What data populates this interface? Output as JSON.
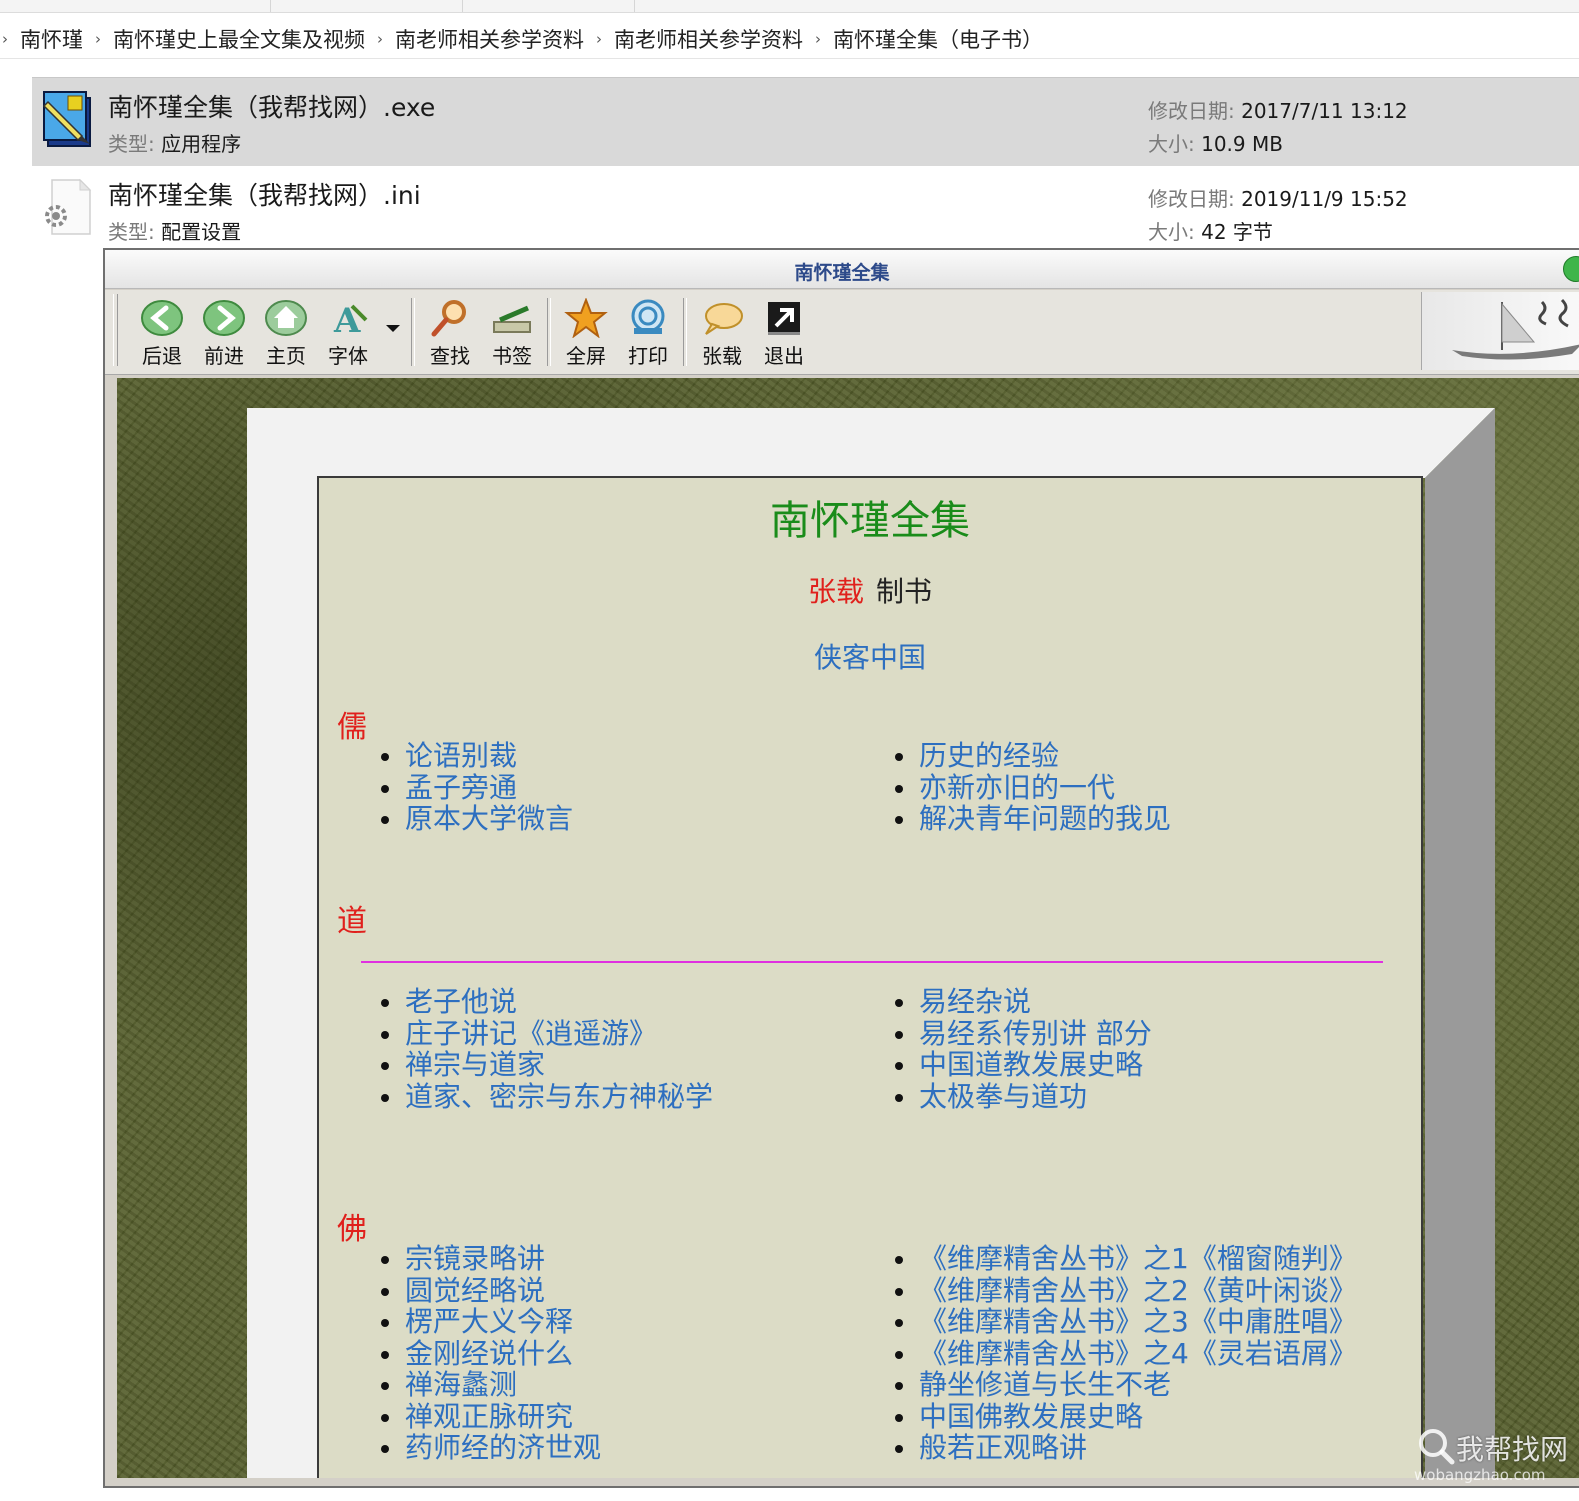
{
  "breadcrumb": {
    "items": [
      "南怀瑾",
      "南怀瑾史上最全文集及视频",
      "南老师相关参学资料",
      "南老师相关参学资料",
      "南怀瑾全集（电子书）"
    ]
  },
  "files": [
    {
      "name": "南怀瑾全集（我帮找网）.exe",
      "type_label": "类型:",
      "type_value": "应用程序",
      "date_label": "修改日期:",
      "date_value": "2017/7/11 13:12",
      "size_label": "大小:",
      "size_value": "10.9 MB",
      "icon": "ebook-app-icon",
      "selected": true
    },
    {
      "name": "南怀瑾全集（我帮找网）.ini",
      "type_label": "类型:",
      "type_value": "配置设置",
      "date_label": "修改日期:",
      "date_value": "2019/11/9 15:52",
      "size_label": "大小:",
      "size_value": "42 字节",
      "icon": "settings-file-icon",
      "selected": false
    }
  ],
  "app": {
    "title": "南怀瑾全集",
    "toolbar": {
      "back": "后退",
      "forward": "前进",
      "home": "主页",
      "font": "字体",
      "find": "查找",
      "bookmark": "书签",
      "fullscreen": "全屏",
      "print": "打印",
      "zhangzai": "张载",
      "exit": "退出"
    },
    "colors": {
      "link": "#2d6fc0",
      "heading": "#e0201c",
      "title": "#1a8c1a",
      "rule": "#e030e0"
    }
  },
  "book": {
    "title": "南怀瑾全集",
    "author": "张载",
    "role": "制书",
    "site_link": "侠客中国",
    "sections": {
      "ru": {
        "heading": "儒",
        "left": [
          "论语别裁",
          "孟子旁通",
          "原本大学微言"
        ],
        "right": [
          "历史的经验",
          "亦新亦旧的一代",
          "解决青年问题的我见"
        ]
      },
      "dao": {
        "heading": "道",
        "left": [
          "老子他说",
          "庄子讲记《逍遥游》",
          "禅宗与道家",
          "道家、密宗与东方神秘学"
        ],
        "right": [
          "易经杂说",
          "易经系传别讲  部分",
          "中国道教发展史略",
          "太极拳与道功"
        ]
      },
      "fo": {
        "heading": "佛",
        "left": [
          "宗镜录略讲",
          "圆觉经略说",
          "楞严大义今释",
          "金刚经说什么",
          "禅海蠡测",
          "禅观正脉研究",
          "药师经的济世观"
        ],
        "right": [
          "《维摩精舍丛书》之1《榴窗随判》",
          "《维摩精舍丛书》之2《黄叶闲谈》",
          "《维摩精舍丛书》之3《中庸胜唱》",
          "《维摩精舍丛书》之4《灵岩语屑》",
          "静坐修道与长生不老",
          "中国佛教发展史略",
          "般若正观略讲"
        ]
      }
    }
  },
  "watermark": {
    "main": "我帮找网",
    "sub": "wobangzhao.com"
  }
}
